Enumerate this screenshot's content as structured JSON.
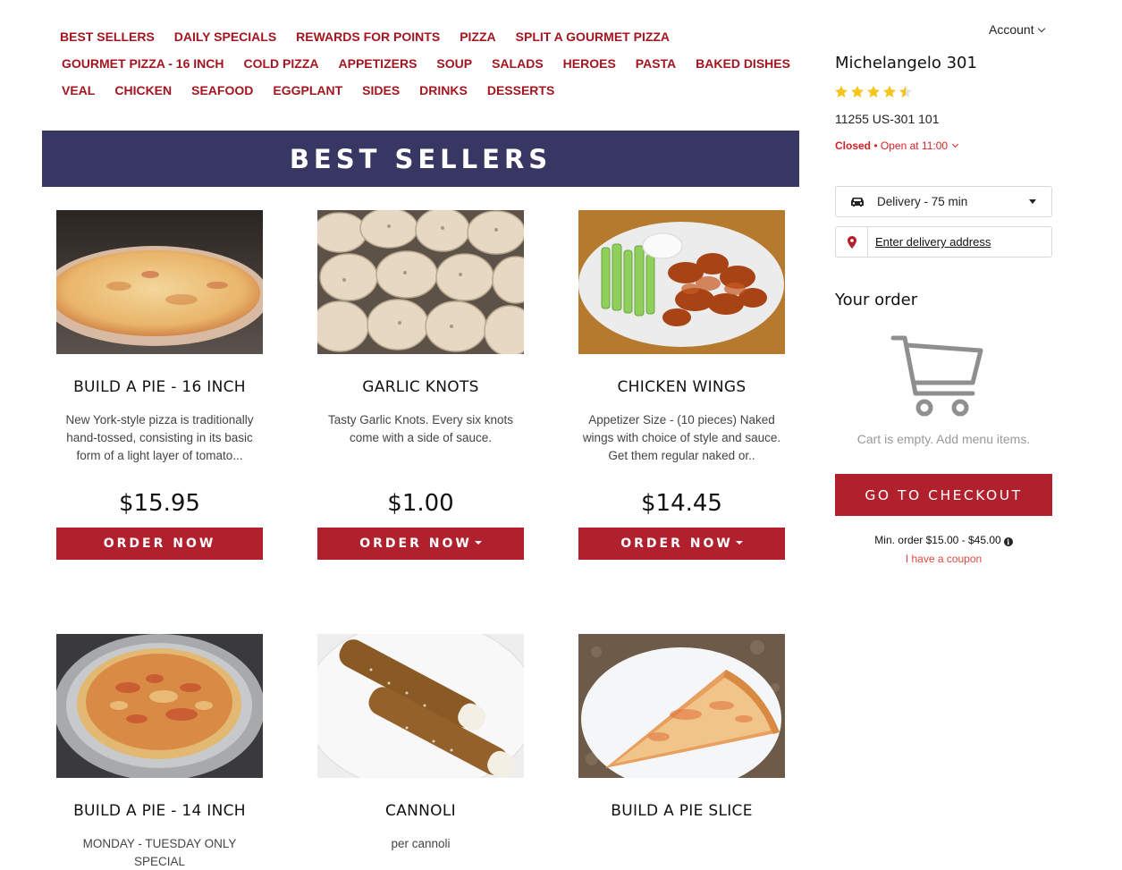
{
  "nav": {
    "rows": [
      [
        "BEST SELLERS",
        "DAILY SPECIALS",
        "REWARDS FOR POINTS",
        "PIZZA",
        "SPLIT A GOURMET PIZZA"
      ],
      [
        "GOURMET PIZZA - 16 INCH",
        "COLD PIZZA",
        "APPETIZERS",
        "SOUP",
        "SALADS",
        "HEROES",
        "PASTA",
        "BAKED DISHES"
      ],
      [
        "VEAL",
        "CHICKEN",
        "SEAFOOD",
        "EGGPLANT",
        "SIDES",
        "DRINKS",
        "DESSERTS"
      ]
    ]
  },
  "section": {
    "title": "BEST SELLERS"
  },
  "products": [
    {
      "name": "BUILD A PIE - 16 INCH",
      "desc": "New York-style pizza is traditionally hand-tossed, consisting in its basic form of a light layer of tomato...",
      "price": "$15.95",
      "order_label": "ORDER NOW",
      "has_dropdown": false,
      "image": "cheese-pizza-16"
    },
    {
      "name": "GARLIC KNOTS",
      "desc": "Tasty Garlic Knots. Every six knots come with a side of sauce.",
      "price": "$1.00",
      "order_label": "ORDER NOW",
      "has_dropdown": true,
      "image": "garlic-knots"
    },
    {
      "name": "CHICKEN WINGS",
      "desc": "Appetizer Size - (10 pieces) Naked wings with choice of style and sauce. Get them regular naked or..",
      "price": "$14.45",
      "order_label": "ORDER NOW",
      "has_dropdown": true,
      "image": "chicken-wings"
    },
    {
      "name": "BUILD A PIE - 14 INCH",
      "desc": "MONDAY - TUESDAY ONLY SPECIAL",
      "image": "cheese-pizza-14"
    },
    {
      "name": "CANNOLI",
      "desc": "per cannoli",
      "image": "cannoli"
    },
    {
      "name": "BUILD A PIE SLICE",
      "desc": "",
      "image": "pizza-slice"
    }
  ],
  "sidebar": {
    "account_label": "Account",
    "store_name": "Michelangelo 301",
    "rating": 4.5,
    "rating_max": 5,
    "star_color": "#f5c518",
    "address": "11255 US-301 101",
    "status_closed": "Closed",
    "status_open": "• Open at 11:00",
    "delivery_label": "Delivery - 75 min",
    "address_placeholder": "Enter delivery address",
    "your_order_title": "Your order",
    "cart_empty_text": "Cart is empty. Add menu items.",
    "checkout_label": "GO TO CHECKOUT",
    "min_order_text": "Min. order $15.00 - $45.00",
    "coupon_text": "I have a coupon"
  },
  "colors": {
    "accent": "#b1202d",
    "nav_link": "#a3161f",
    "banner_bg": "#383763",
    "status_red": "#d81e25"
  }
}
